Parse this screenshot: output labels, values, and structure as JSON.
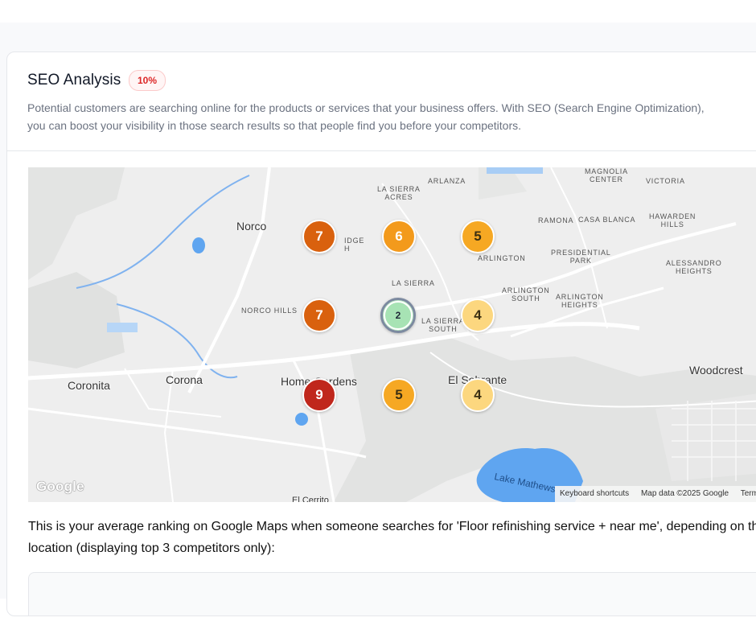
{
  "seo": {
    "title": "SEO Analysis",
    "score_badge": "10%",
    "description": "Potential customers are searching online for the products or services that your business offers. With SEO (Search Engine Optimization), you can boost your visibility in those search results so that people find you before your competitors."
  },
  "map": {
    "places": {
      "la_sierra_acres": "LA SIERRA\nACRES",
      "arlanza": "ARLANZA",
      "magnolia_center": "MAGNOLIA\nCENTER",
      "victoria": "VICTORIA",
      "ramona": "RAMONA",
      "casa_blanca": "CASA BLANCA",
      "hawarden_hills": "HAWARDEN\nHILLS",
      "presidential_park": "PRESIDENTIAL\nPARK",
      "arlington": "ARLINGTON",
      "alessandro_heights": "ALESSANDRO\nHEIGHTS",
      "la_sierra": "LA SIERRA",
      "arlington_south": "ARLINGTON\nSOUTH",
      "arlington_heights": "ARLINGTON\nHEIGHTS",
      "norco_hills": "NORCO HILLS",
      "la_sierra_south": "LA SIERRA\nSOUTH",
      "ridge": "IDGE\nH"
    },
    "cities": {
      "norco": "Norco",
      "corona": "Corona",
      "coronita": "Coronita",
      "home_gardens": "Home Gardens",
      "el_sobrante": "El Sobrante",
      "woodcrest": "Woodcrest",
      "lake_mathews": "Lake Mathews",
      "el_cerrito": "El Cerrito"
    },
    "pins": [
      {
        "rank": "7",
        "color": "#d9610e"
      },
      {
        "rank": "6",
        "color": "#f39a1c"
      },
      {
        "rank": "5",
        "color": "#f6a823"
      },
      {
        "rank": "7",
        "color": "#d9610e"
      },
      {
        "rank": "2",
        "color": "#a7e3b4"
      },
      {
        "rank": "4",
        "color": "#fcd77f"
      },
      {
        "rank": "9",
        "color": "#c0271c"
      },
      {
        "rank": "5",
        "color": "#f6a823"
      },
      {
        "rank": "4",
        "color": "#fcd77f"
      }
    ],
    "google_logo": "Google",
    "attribution": {
      "shortcuts": "Keyboard shortcuts",
      "data": "Map data ©2025 Google",
      "terms": "Terms"
    }
  },
  "ranking_note": "This is your average ranking on Google Maps when someone searches for 'Floor refinishing service + near me', depending on their location (displaying top 3 competitors only):"
}
